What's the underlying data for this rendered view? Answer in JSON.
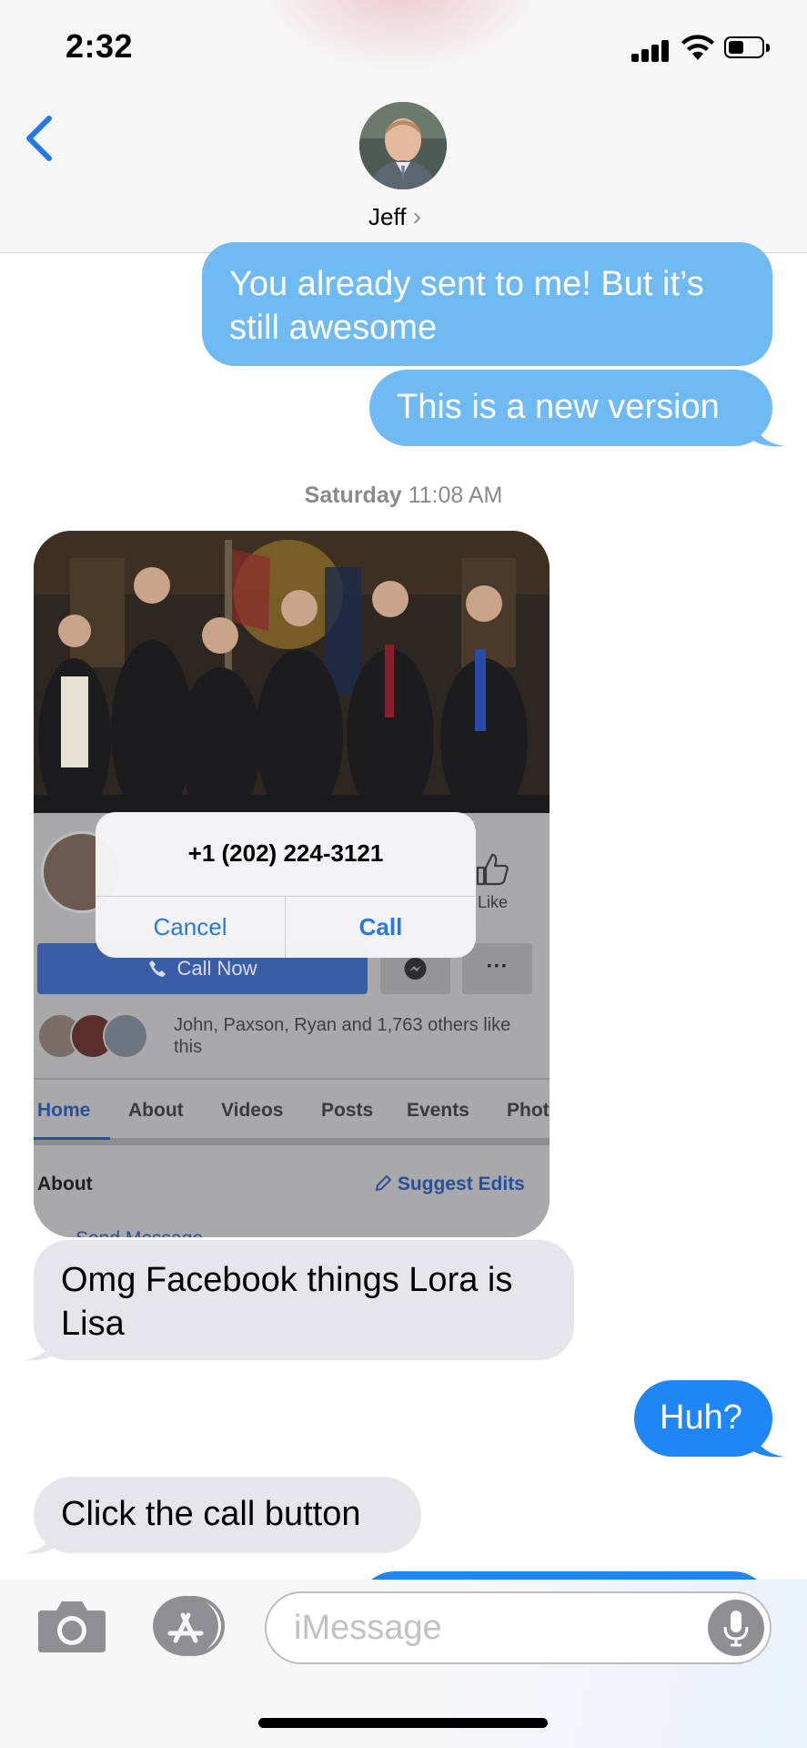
{
  "status_bar": {
    "time": "2:32"
  },
  "header": {
    "contact_name": "Jeff",
    "contact_chevron": "›"
  },
  "messages": {
    "m1": "You already sent to me! But it’s still awesome",
    "m2": "This is a new version",
    "timestamp_day": "Saturday",
    "timestamp_time": "11:08 AM",
    "m3": "Omg Facebook things Lora is Lisa",
    "m4": "Huh?",
    "m5": "Click the call button"
  },
  "shared_screenshot": {
    "like_label": "Like",
    "call_now": "Call Now",
    "more": "···",
    "likes_text": "John, Paxson, Ryan and 1,763 others like this",
    "tabs": [
      "Home",
      "About",
      "Videos",
      "Posts",
      "Events",
      "Phot"
    ],
    "about_label": "About",
    "suggest_edits": "Suggest Edits",
    "send_message": "Send Message"
  },
  "alert": {
    "title": "+1 (202) 224-3121",
    "cancel": "Cancel",
    "call": "Call"
  },
  "compose": {
    "placeholder": "iMessage"
  },
  "icons": {
    "back": "back-chevron-icon",
    "camera": "camera-icon",
    "appstore": "app-store-icon",
    "mic": "microphone-icon",
    "signal": "cellular-signal-icon",
    "wifi": "wifi-icon",
    "battery": "battery-icon"
  },
  "colors": {
    "accent": "#2379e8",
    "sent_bubble": "#1f87f5",
    "sent_bubble_sending": "#6fbaf2",
    "received_bubble": "#e6e6ea"
  }
}
